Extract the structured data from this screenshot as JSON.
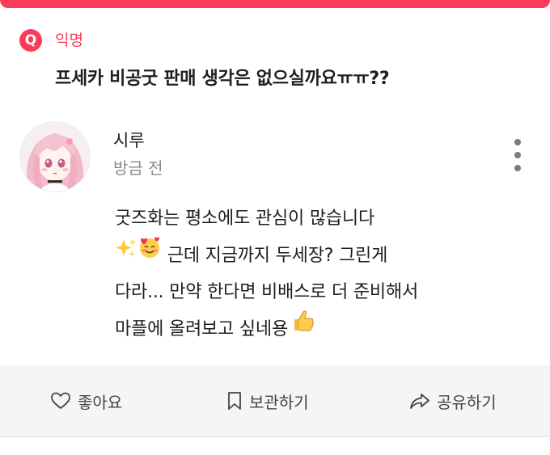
{
  "question": {
    "badge": "Q",
    "author": "익명",
    "text": "프세카 비공굿 판매 생각은 없으실까요ㅠㅠ??"
  },
  "answer": {
    "author_name": "시루",
    "time": "방금 전",
    "lines": [
      "굿즈화는 평소에도 관심이 많습니다",
      "근데 지금까지 두세장? 그린게",
      "다라... 만약 한다면 비배스로 더 준비해서",
      "마플에 올려보고 싶네용"
    ],
    "emoji": [
      "sparkles",
      "smiling-face-with-hearts",
      "thumbs-up"
    ]
  },
  "actions": {
    "like_label": "좋아요",
    "save_label": "보관하기",
    "share_label": "공유하기"
  },
  "colors": {
    "accent": "#fa3c5a",
    "action_bar_bg": "#f5f5f5"
  }
}
